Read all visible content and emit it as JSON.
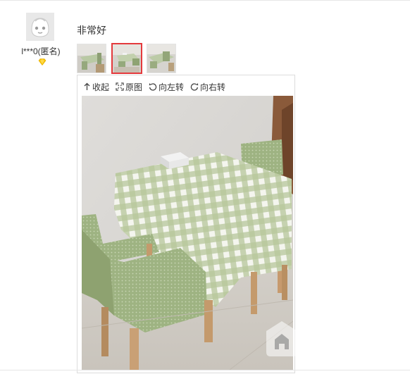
{
  "review": {
    "user": {
      "name": "l***0(匿名)",
      "avatar_icon": "default-avatar-icon",
      "level_icon": "vip-diamond-icon",
      "level_color": "#f7c300"
    },
    "text": "非常好",
    "thumbnails": [
      {
        "selected": false
      },
      {
        "selected": true
      },
      {
        "selected": false
      }
    ],
    "accent_color": "#e4393c",
    "viewer": {
      "toolbar": [
        {
          "label": "收起",
          "icon": "collapse-arrow-icon"
        },
        {
          "label": "原图",
          "icon": "fullscreen-icon"
        },
        {
          "label": "向左转",
          "icon": "rotate-left-icon"
        },
        {
          "label": "向右转",
          "icon": "rotate-right-icon"
        }
      ]
    }
  }
}
